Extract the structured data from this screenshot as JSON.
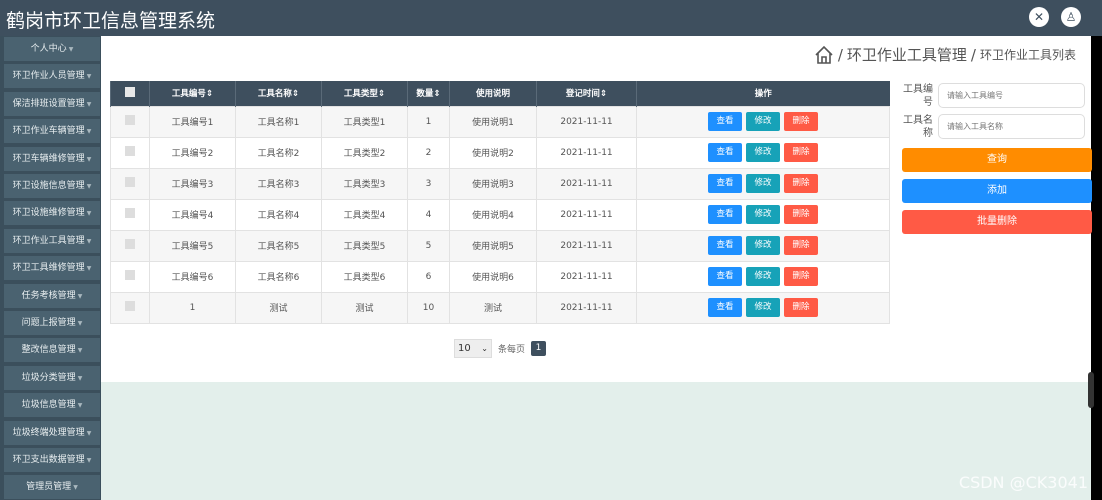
{
  "app": {
    "title": "鹤岗市环卫信息管理系统",
    "icons": [
      "fullscreen-icon",
      "user-icon"
    ]
  },
  "sidebar": {
    "items": [
      "个人中心",
      "环卫作业人员管理",
      "保洁排班设置管理",
      "环卫作业车辆管理",
      "环卫车辆维修管理",
      "环卫设施信息管理",
      "环卫设施维修管理",
      "环卫作业工具管理",
      "环卫工具维修管理",
      "任务考核管理",
      "问题上报管理",
      "整改信息管理",
      "垃圾分类管理",
      "垃圾信息管理",
      "垃圾终端处理管理",
      "环卫支出数据管理",
      "管理员管理"
    ]
  },
  "breadcrumb": {
    "icon": "home-icon",
    "sep": "/",
    "level1": "环卫作业工具管理",
    "level2": "环卫作业工具列表"
  },
  "table": {
    "headers": [
      "工具编号",
      "工具名称",
      "工具类型",
      "数量",
      "使用说明",
      "登记时间",
      "操作"
    ],
    "rows": [
      [
        "工具编号1",
        "工具名称1",
        "工具类型1",
        "1",
        "使用说明1",
        "2021-11-11"
      ],
      [
        "工具编号2",
        "工具名称2",
        "工具类型2",
        "2",
        "使用说明2",
        "2021-11-11"
      ],
      [
        "工具编号3",
        "工具名称3",
        "工具类型3",
        "3",
        "使用说明3",
        "2021-11-11"
      ],
      [
        "工具编号4",
        "工具名称4",
        "工具类型4",
        "4",
        "使用说明4",
        "2021-11-11"
      ],
      [
        "工具编号5",
        "工具名称5",
        "工具类型5",
        "5",
        "使用说明5",
        "2021-11-11"
      ],
      [
        "工具编号6",
        "工具名称6",
        "工具类型6",
        "6",
        "使用说明6",
        "2021-11-11"
      ],
      [
        "1",
        "测试",
        "测试",
        "10",
        "测试",
        "2021-11-11"
      ]
    ],
    "actions": {
      "view": "查看",
      "edit": "修改",
      "delete": "删除"
    }
  },
  "search": {
    "code_label": "工具编号",
    "code_placeholder": "请输入工具编号",
    "name_label": "工具名称",
    "name_placeholder": "请输入工具名称",
    "query": "查询",
    "add": "添加",
    "batch_delete": "批量删除"
  },
  "pager": {
    "page_size": "10",
    "per_page_label": "条每页",
    "current_page": "1"
  },
  "watermark": "CSDN @CK3041",
  "colors": {
    "header": "#3e4f5e",
    "query": "#ff8c00",
    "add": "#1e90ff",
    "delete": "#ff5a45",
    "edit": "#17a2b8"
  }
}
